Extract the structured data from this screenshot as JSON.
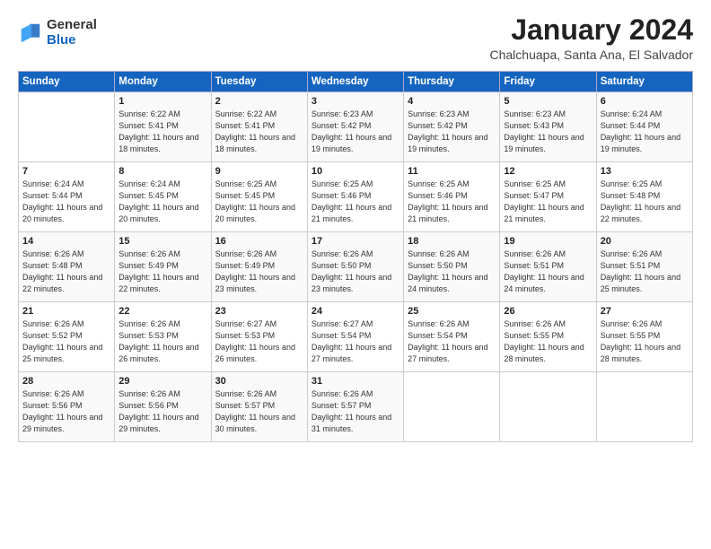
{
  "header": {
    "logo_general": "General",
    "logo_blue": "Blue",
    "month_title": "January 2024",
    "location": "Chalchuapa, Santa Ana, El Salvador"
  },
  "days_of_week": [
    "Sunday",
    "Monday",
    "Tuesday",
    "Wednesday",
    "Thursday",
    "Friday",
    "Saturday"
  ],
  "weeks": [
    [
      {
        "day": "",
        "sunrise": "",
        "sunset": "",
        "daylight": ""
      },
      {
        "day": "1",
        "sunrise": "Sunrise: 6:22 AM",
        "sunset": "Sunset: 5:41 PM",
        "daylight": "Daylight: 11 hours and 18 minutes."
      },
      {
        "day": "2",
        "sunrise": "Sunrise: 6:22 AM",
        "sunset": "Sunset: 5:41 PM",
        "daylight": "Daylight: 11 hours and 18 minutes."
      },
      {
        "day": "3",
        "sunrise": "Sunrise: 6:23 AM",
        "sunset": "Sunset: 5:42 PM",
        "daylight": "Daylight: 11 hours and 19 minutes."
      },
      {
        "day": "4",
        "sunrise": "Sunrise: 6:23 AM",
        "sunset": "Sunset: 5:42 PM",
        "daylight": "Daylight: 11 hours and 19 minutes."
      },
      {
        "day": "5",
        "sunrise": "Sunrise: 6:23 AM",
        "sunset": "Sunset: 5:43 PM",
        "daylight": "Daylight: 11 hours and 19 minutes."
      },
      {
        "day": "6",
        "sunrise": "Sunrise: 6:24 AM",
        "sunset": "Sunset: 5:44 PM",
        "daylight": "Daylight: 11 hours and 19 minutes."
      }
    ],
    [
      {
        "day": "7",
        "sunrise": "Sunrise: 6:24 AM",
        "sunset": "Sunset: 5:44 PM",
        "daylight": "Daylight: 11 hours and 20 minutes."
      },
      {
        "day": "8",
        "sunrise": "Sunrise: 6:24 AM",
        "sunset": "Sunset: 5:45 PM",
        "daylight": "Daylight: 11 hours and 20 minutes."
      },
      {
        "day": "9",
        "sunrise": "Sunrise: 6:25 AM",
        "sunset": "Sunset: 5:45 PM",
        "daylight": "Daylight: 11 hours and 20 minutes."
      },
      {
        "day": "10",
        "sunrise": "Sunrise: 6:25 AM",
        "sunset": "Sunset: 5:46 PM",
        "daylight": "Daylight: 11 hours and 21 minutes."
      },
      {
        "day": "11",
        "sunrise": "Sunrise: 6:25 AM",
        "sunset": "Sunset: 5:46 PM",
        "daylight": "Daylight: 11 hours and 21 minutes."
      },
      {
        "day": "12",
        "sunrise": "Sunrise: 6:25 AM",
        "sunset": "Sunset: 5:47 PM",
        "daylight": "Daylight: 11 hours and 21 minutes."
      },
      {
        "day": "13",
        "sunrise": "Sunrise: 6:25 AM",
        "sunset": "Sunset: 5:48 PM",
        "daylight": "Daylight: 11 hours and 22 minutes."
      }
    ],
    [
      {
        "day": "14",
        "sunrise": "Sunrise: 6:26 AM",
        "sunset": "Sunset: 5:48 PM",
        "daylight": "Daylight: 11 hours and 22 minutes."
      },
      {
        "day": "15",
        "sunrise": "Sunrise: 6:26 AM",
        "sunset": "Sunset: 5:49 PM",
        "daylight": "Daylight: 11 hours and 22 minutes."
      },
      {
        "day": "16",
        "sunrise": "Sunrise: 6:26 AM",
        "sunset": "Sunset: 5:49 PM",
        "daylight": "Daylight: 11 hours and 23 minutes."
      },
      {
        "day": "17",
        "sunrise": "Sunrise: 6:26 AM",
        "sunset": "Sunset: 5:50 PM",
        "daylight": "Daylight: 11 hours and 23 minutes."
      },
      {
        "day": "18",
        "sunrise": "Sunrise: 6:26 AM",
        "sunset": "Sunset: 5:50 PM",
        "daylight": "Daylight: 11 hours and 24 minutes."
      },
      {
        "day": "19",
        "sunrise": "Sunrise: 6:26 AM",
        "sunset": "Sunset: 5:51 PM",
        "daylight": "Daylight: 11 hours and 24 minutes."
      },
      {
        "day": "20",
        "sunrise": "Sunrise: 6:26 AM",
        "sunset": "Sunset: 5:51 PM",
        "daylight": "Daylight: 11 hours and 25 minutes."
      }
    ],
    [
      {
        "day": "21",
        "sunrise": "Sunrise: 6:26 AM",
        "sunset": "Sunset: 5:52 PM",
        "daylight": "Daylight: 11 hours and 25 minutes."
      },
      {
        "day": "22",
        "sunrise": "Sunrise: 6:26 AM",
        "sunset": "Sunset: 5:53 PM",
        "daylight": "Daylight: 11 hours and 26 minutes."
      },
      {
        "day": "23",
        "sunrise": "Sunrise: 6:27 AM",
        "sunset": "Sunset: 5:53 PM",
        "daylight": "Daylight: 11 hours and 26 minutes."
      },
      {
        "day": "24",
        "sunrise": "Sunrise: 6:27 AM",
        "sunset": "Sunset: 5:54 PM",
        "daylight": "Daylight: 11 hours and 27 minutes."
      },
      {
        "day": "25",
        "sunrise": "Sunrise: 6:26 AM",
        "sunset": "Sunset: 5:54 PM",
        "daylight": "Daylight: 11 hours and 27 minutes."
      },
      {
        "day": "26",
        "sunrise": "Sunrise: 6:26 AM",
        "sunset": "Sunset: 5:55 PM",
        "daylight": "Daylight: 11 hours and 28 minutes."
      },
      {
        "day": "27",
        "sunrise": "Sunrise: 6:26 AM",
        "sunset": "Sunset: 5:55 PM",
        "daylight": "Daylight: 11 hours and 28 minutes."
      }
    ],
    [
      {
        "day": "28",
        "sunrise": "Sunrise: 6:26 AM",
        "sunset": "Sunset: 5:56 PM",
        "daylight": "Daylight: 11 hours and 29 minutes."
      },
      {
        "day": "29",
        "sunrise": "Sunrise: 6:26 AM",
        "sunset": "Sunset: 5:56 PM",
        "daylight": "Daylight: 11 hours and 29 minutes."
      },
      {
        "day": "30",
        "sunrise": "Sunrise: 6:26 AM",
        "sunset": "Sunset: 5:57 PM",
        "daylight": "Daylight: 11 hours and 30 minutes."
      },
      {
        "day": "31",
        "sunrise": "Sunrise: 6:26 AM",
        "sunset": "Sunset: 5:57 PM",
        "daylight": "Daylight: 11 hours and 31 minutes."
      },
      {
        "day": "",
        "sunrise": "",
        "sunset": "",
        "daylight": ""
      },
      {
        "day": "",
        "sunrise": "",
        "sunset": "",
        "daylight": ""
      },
      {
        "day": "",
        "sunrise": "",
        "sunset": "",
        "daylight": ""
      }
    ]
  ]
}
